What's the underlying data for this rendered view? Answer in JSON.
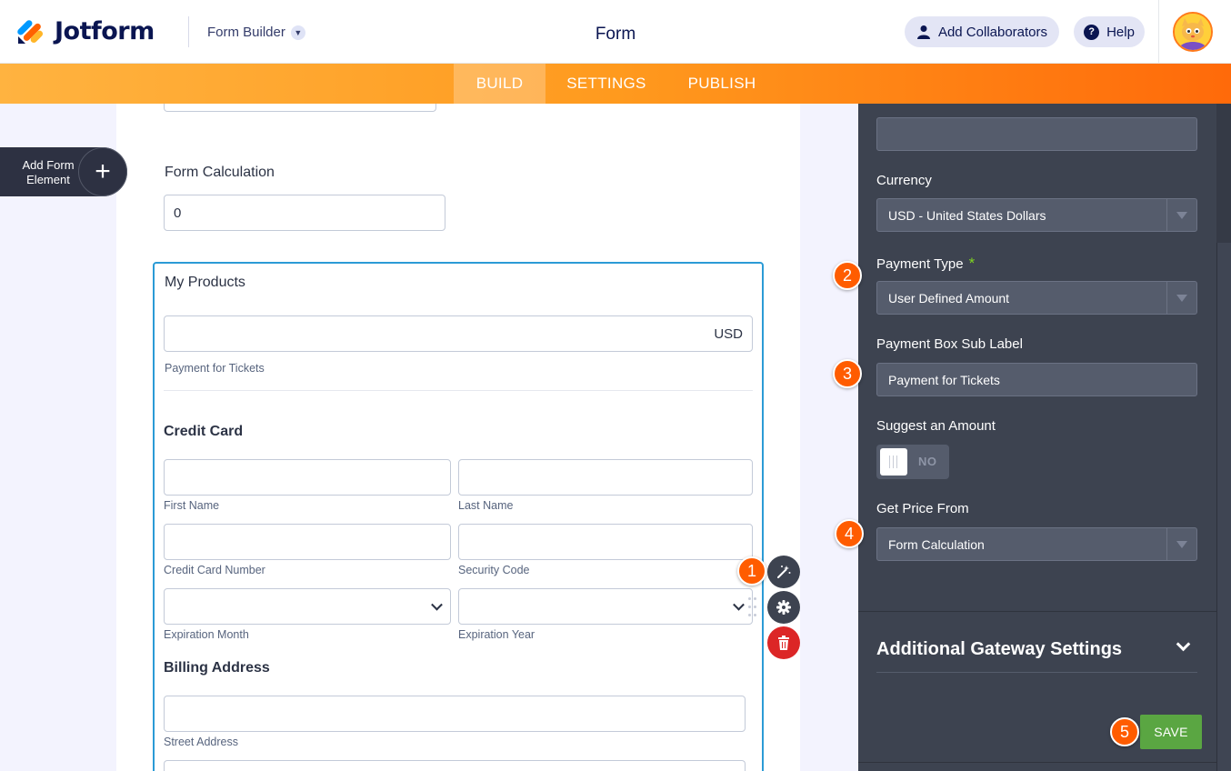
{
  "header": {
    "logo_text": "Jotform",
    "builder_label": "Form Builder",
    "form_title": "Form",
    "collaborators_label": "Add Collaborators",
    "help_label": "Help"
  },
  "nav": {
    "tabs": [
      {
        "label": "BUILD",
        "active": true
      },
      {
        "label": "SETTINGS",
        "active": false
      },
      {
        "label": "PUBLISH",
        "active": false
      }
    ]
  },
  "sidebar": {
    "add_element_label": "Add Form Element"
  },
  "form": {
    "calc_label": "Form Calculation",
    "calc_value": "0",
    "products_label": "My Products",
    "amount_currency": "USD",
    "amount_sublabel": "Payment for Tickets",
    "credit_card_heading": "Credit Card",
    "first_name": "First Name",
    "last_name": "Last Name",
    "cc_number": "Credit Card Number",
    "security_code": "Security Code",
    "exp_month": "Expiration Month",
    "exp_year": "Expiration Year",
    "billing_heading": "Billing Address",
    "street_address": "Street Address"
  },
  "badges": [
    "1",
    "2",
    "3",
    "4",
    "5"
  ],
  "panel": {
    "currency_label": "Currency",
    "currency_value": "USD - United States Dollars",
    "payment_type_label": "Payment Type",
    "required_mark": "*",
    "payment_type_value": "User Defined Amount",
    "sub_label_label": "Payment Box Sub Label",
    "sub_label_value": "Payment for Tickets",
    "suggest_label": "Suggest an Amount",
    "suggest_toggle": "NO",
    "price_from_label": "Get Price From",
    "price_from_value": "Form Calculation",
    "additional_settings": "Additional Gateway Settings",
    "save_label": "SAVE"
  },
  "colors": {
    "brand_orange": "#ff6100",
    "selected_border": "#2b9bd6",
    "panel_bg": "#3d4350",
    "save_green": "#5aa642"
  }
}
